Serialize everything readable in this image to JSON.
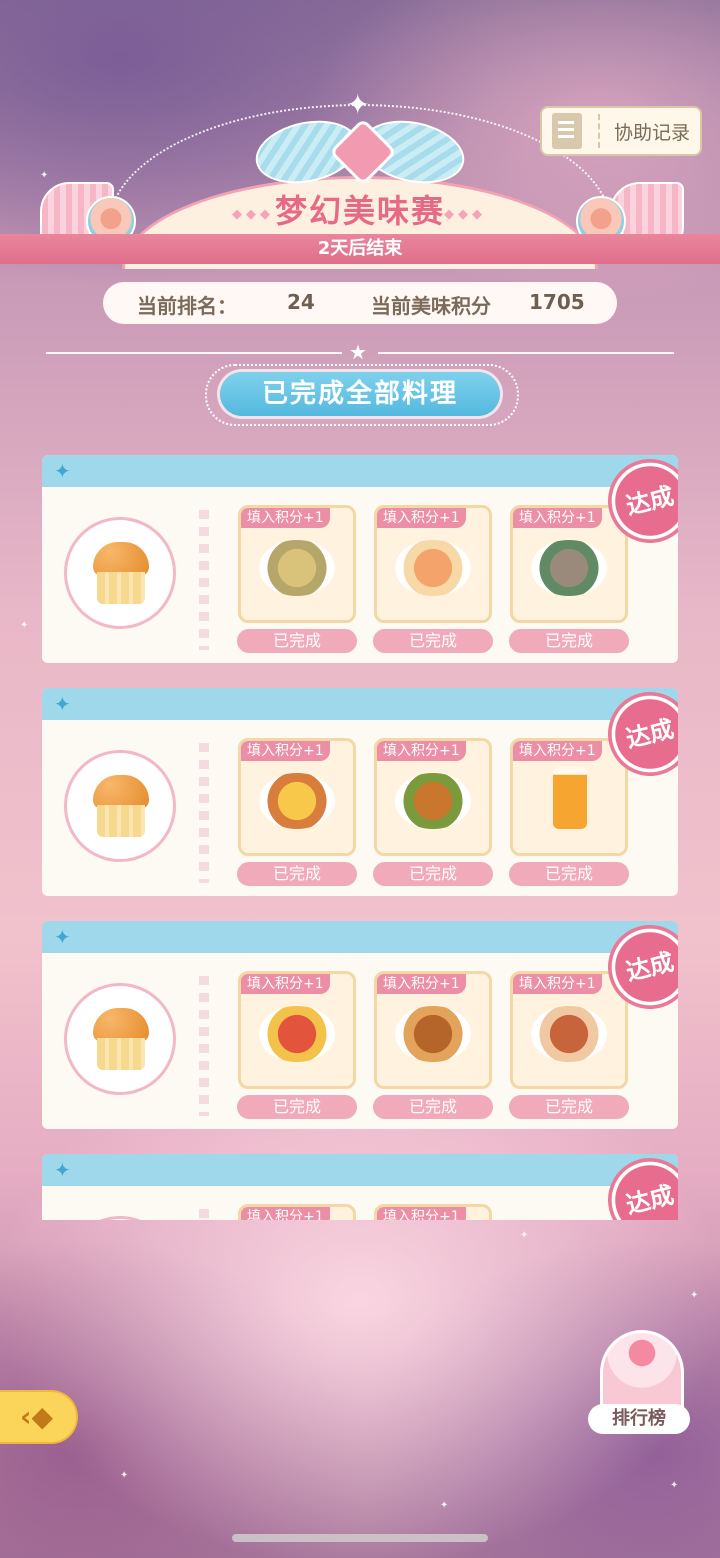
{
  "header": {
    "title": "梦幻美味赛",
    "subtitle": "2天后结束",
    "assist_label": "协助记录"
  },
  "stats": {
    "rank_label": "当前排名：",
    "rank_value": "24",
    "score_label": "当前美味积分",
    "score_value": "1705"
  },
  "status_pill": "已完成全部料理",
  "cards": [
    {
      "badge": "达成",
      "dishes": [
        {
          "tag": "填入积分+1",
          "status": "已完成",
          "icon": "stir-fried-noodles-icon"
        },
        {
          "tag": "填入积分+1",
          "status": "已完成",
          "icon": "shrimp-tofu-icon"
        },
        {
          "tag": "填入积分+1",
          "status": "已完成",
          "icon": "mushroom-dish-icon"
        }
      ]
    },
    {
      "badge": "达成",
      "dishes": [
        {
          "tag": "填入积分+1",
          "status": "已完成",
          "icon": "fried-egg-dish-icon"
        },
        {
          "tag": "填入积分+1",
          "status": "已完成",
          "icon": "stir-fried-vegetables-icon"
        },
        {
          "tag": "填入积分+1",
          "status": "已完成",
          "icon": "carrot-juice-icon"
        }
      ]
    },
    {
      "badge": "达成",
      "dishes": [
        {
          "tag": "填入积分+1",
          "status": "已完成",
          "icon": "tomato-egg-icon"
        },
        {
          "tag": "填入积分+1",
          "status": "已完成",
          "icon": "grilled-fish-icon"
        },
        {
          "tag": "填入积分+1",
          "status": "已完成",
          "icon": "beef-noodle-soup-icon"
        }
      ]
    },
    {
      "badge": "达成",
      "dishes": [
        {
          "tag": "填入积分+1",
          "status": "",
          "icon": "dish-icon"
        },
        {
          "tag": "填入积分+1",
          "status": "",
          "icon": "dish-icon"
        }
      ]
    }
  ],
  "ranking_label": "排行榜",
  "colors": {
    "accent_pink": "#e66a86",
    "ribbon_pink": "#de6f8a",
    "sky_blue": "#9ed8ea",
    "badge_pink": "#e76c8e",
    "done_pink": "#f0aab9"
  }
}
